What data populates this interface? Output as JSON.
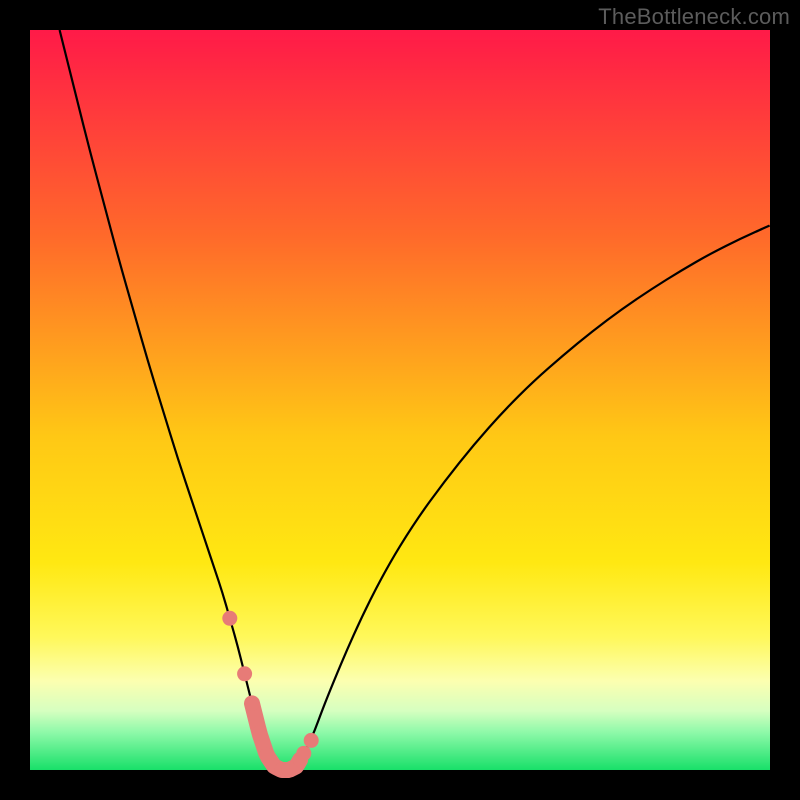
{
  "watermark": {
    "text": "TheBottleneck.com"
  },
  "colors": {
    "black": "#000000",
    "curve": "#000000",
    "salmon": "#e77b77",
    "grad_stop_0": "#ff1a48",
    "grad_stop_28": "#ff6a2a",
    "grad_stop_55": "#ffc815",
    "grad_stop_72": "#ffe812",
    "grad_stop_82": "#fff85a",
    "grad_stop_88": "#fcffb0",
    "grad_stop_92": "#d6ffc0",
    "grad_stop_95": "#8cf9a8",
    "grad_stop_100": "#18e069"
  },
  "chart_data": {
    "type": "line",
    "title": "",
    "xlabel": "",
    "ylabel": "",
    "xlim": [
      0,
      100
    ],
    "ylim": [
      0,
      100
    ],
    "x": [
      4,
      6,
      8,
      10,
      12,
      14,
      16,
      18,
      20,
      22,
      24,
      25,
      26,
      27,
      28,
      29,
      30,
      31,
      32,
      33,
      34,
      35,
      36,
      38,
      40,
      44,
      48,
      52,
      56,
      60,
      64,
      68,
      72,
      76,
      80,
      84,
      88,
      92,
      96,
      100
    ],
    "values": [
      100,
      92,
      84,
      76.5,
      69,
      62,
      55,
      48.5,
      42,
      36,
      30,
      27,
      24,
      20.5,
      17,
      13,
      9,
      5,
      2,
      0.5,
      0,
      0,
      0.5,
      4,
      9.5,
      19,
      27,
      33.5,
      39,
      44,
      48.5,
      52.5,
      56,
      59.3,
      62.3,
      65,
      67.5,
      69.8,
      71.8,
      73.6
    ],
    "highlight_points_x": [
      27,
      29,
      30,
      31,
      32,
      33,
      34,
      35,
      36,
      36.5,
      37,
      38
    ],
    "highlight_range_x": [
      30,
      36.5
    ]
  }
}
